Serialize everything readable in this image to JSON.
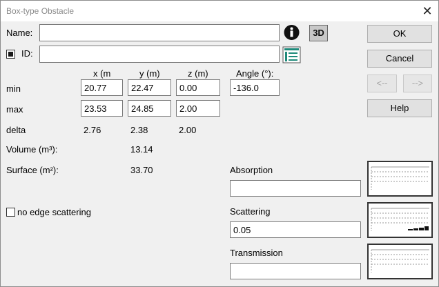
{
  "window": {
    "title": "Box-type Obstacle",
    "close_glyph": "✕"
  },
  "form": {
    "name_label": "Name:",
    "name_value": "",
    "id_label": "ID:",
    "id_checked": true,
    "id_value": ""
  },
  "icons": {
    "info": "info-icon",
    "threed": "3D",
    "id_list": "list-picker-icon"
  },
  "grid": {
    "headers": {
      "x": "x (m",
      "y": "y (m)",
      "z": "z (m)",
      "angle": "Angle (°):"
    },
    "min_label": "min",
    "max_label": "max",
    "delta_label": "delta",
    "min": {
      "x": "20.77",
      "y": "22.47",
      "z": "0.00",
      "angle": "-136.0"
    },
    "max": {
      "x": "23.53",
      "y": "24.85",
      "z": "2.00"
    },
    "delta": {
      "x": "2.76",
      "y": "2.38",
      "z": "2.00"
    }
  },
  "stats": {
    "volume_label": "Volume (m³):",
    "volume_value": "13.14",
    "surface_label": "Surface (m²):",
    "surface_value": "33.70"
  },
  "options": {
    "no_edge_label": "no edge scattering",
    "no_edge_checked": false
  },
  "coefficients": {
    "absorption_label": "Absorption",
    "absorption_value": "",
    "scattering_label": "Scattering",
    "scattering_value": "0.05",
    "transmission_label": "Transmission",
    "transmission_value": ""
  },
  "buttons": {
    "ok": "OK",
    "cancel": "Cancel",
    "prev": "<--",
    "next": "-->",
    "help": "Help"
  },
  "colors": {
    "info_bg": "#111111",
    "teal": "#1e8a7a",
    "graph_bar": "#111111"
  }
}
